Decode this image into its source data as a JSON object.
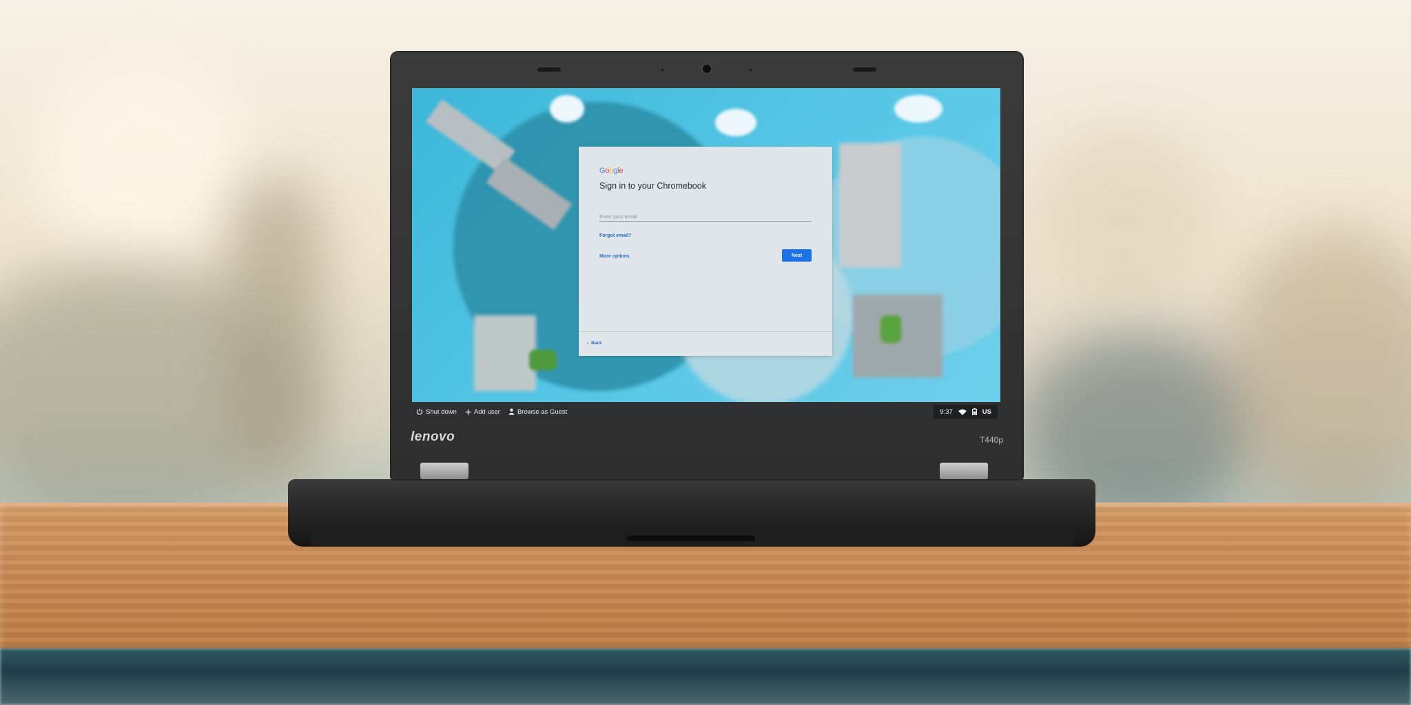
{
  "signin": {
    "logo": "Google",
    "title": "Sign in to your Chromebook",
    "email_placeholder": "Enter your email",
    "forgot_email": "Forgot email?",
    "more_options": "More options",
    "next": "Next",
    "back": "Back"
  },
  "shelf": {
    "shutdown": "Shut down",
    "add_user": "Add user",
    "guest": "Browse as Guest"
  },
  "status": {
    "time": "9:37",
    "wifi_icon": "wifi-icon",
    "battery_icon": "battery-icon",
    "language": "US"
  },
  "device": {
    "brand": "lenovo",
    "model": "T440p"
  },
  "colors": {
    "accent": "#1a73e8",
    "card_bg": "#dfe5e8",
    "shelf_bg": "#2d2f31"
  }
}
